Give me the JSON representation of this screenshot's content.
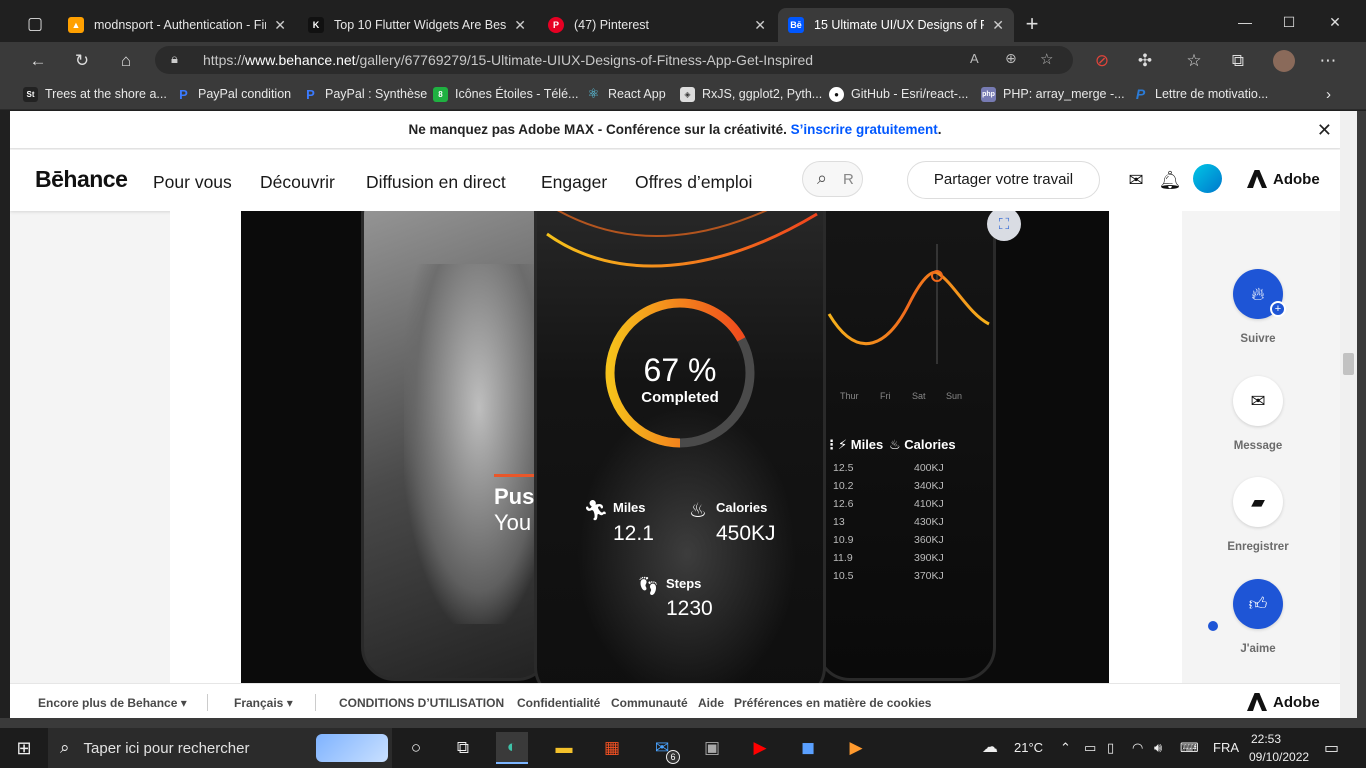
{
  "browser": {
    "tabs": [
      {
        "title": "modnsport - Authentication - Fir",
        "icon": "firebase-icon",
        "color": "#ffa000",
        "active": false
      },
      {
        "title": "Top 10 Flutter Widgets Are Best",
        "icon": "k-logo-icon",
        "color": "#111111",
        "active": false
      },
      {
        "title": "(47) Pinterest",
        "icon": "pinterest-icon",
        "color": "#e60023",
        "active": false
      },
      {
        "title": "15 Ultimate UI/UX Designs of Fit",
        "icon": "behance-icon",
        "color": "#0057ff",
        "active": true
      }
    ],
    "url_prefix": "https://",
    "url_domain": "www.behance.net",
    "url_path": "/gallery/67769279/15-Ultimate-UIUX-Designs-of-Fitness-App-Get-Inspired",
    "bookmarks": [
      {
        "label": "Trees at the shore a...",
        "icon": "st-icon",
        "color": "#222"
      },
      {
        "label": "PayPal condition",
        "icon": "paypal-icon",
        "color": "#003087"
      },
      {
        "label": "PayPal : Synthèse",
        "icon": "paypal-icon",
        "color": "#003087"
      },
      {
        "label": "Icônes Étoiles - Télé...",
        "icon": "icons8-icon",
        "color": "#1fb141"
      },
      {
        "label": "React App",
        "icon": "react-icon",
        "color": "#61dafb"
      },
      {
        "label": "RxJS, ggplot2, Pyth...",
        "icon": "nav-icon",
        "color": "#666"
      },
      {
        "label": "GitHub - Esri/react-...",
        "icon": "github-icon",
        "color": "#fff"
      },
      {
        "label": "PHP: array_merge -...",
        "icon": "php-icon",
        "color": "#777bb3"
      },
      {
        "label": "Lettre de motivatio...",
        "icon": "p-icon",
        "color": "#2b7bd6"
      }
    ]
  },
  "banner": {
    "text": "Ne manquez pas Adobe MAX - Conférence sur la créativité.",
    "link": "S’inscrire gratuitement",
    "suffix": "."
  },
  "header": {
    "logo": "Bēhance",
    "nav": [
      "Pour vous",
      "Découvrir",
      "Diffusion en direct",
      "Engager",
      "Offres d’emploi"
    ],
    "search_placeholder": "R",
    "share_label": "Partager votre travail",
    "adobe_label": "Adobe"
  },
  "hero": {
    "percent": "67 %",
    "completed": "Completed",
    "miles_label": "Miles",
    "miles_value": "12.1",
    "calories_label": "Calories",
    "calories_value": "450KJ",
    "steps_label": "Steps",
    "steps_value": "1230",
    "push_text": "Pus",
    "you_text": "You",
    "days": [
      "Thur",
      "Fri",
      "Sat",
      "Sun"
    ],
    "table_miles": [
      "12.5",
      "10.2",
      "12.6",
      "13",
      "10.9",
      "11.9",
      "10.5"
    ],
    "table_calories": [
      "400KJ",
      "340KJ",
      "410KJ",
      "430KJ",
      "360KJ",
      "390KJ",
      "370KJ"
    ],
    "progress_fraction": 0.67
  },
  "sidebar": {
    "follow": "Suivre",
    "message": "Message",
    "save": "Enregistrer",
    "like": "J'aime"
  },
  "footer": {
    "more": "Encore plus de Behance",
    "language": "Français",
    "links": [
      "CONDITIONS D’UTILISATION",
      "Confidentialité",
      "Communauté",
      "Aide",
      "Préférences en matière de cookies"
    ],
    "adobe": "Adobe"
  },
  "taskbar": {
    "search_placeholder": "Taper ici pour rechercher",
    "weather": "21°C",
    "lang": "FRA",
    "time": "22:53",
    "date": "09/10/2022",
    "mail_badge": "6"
  }
}
